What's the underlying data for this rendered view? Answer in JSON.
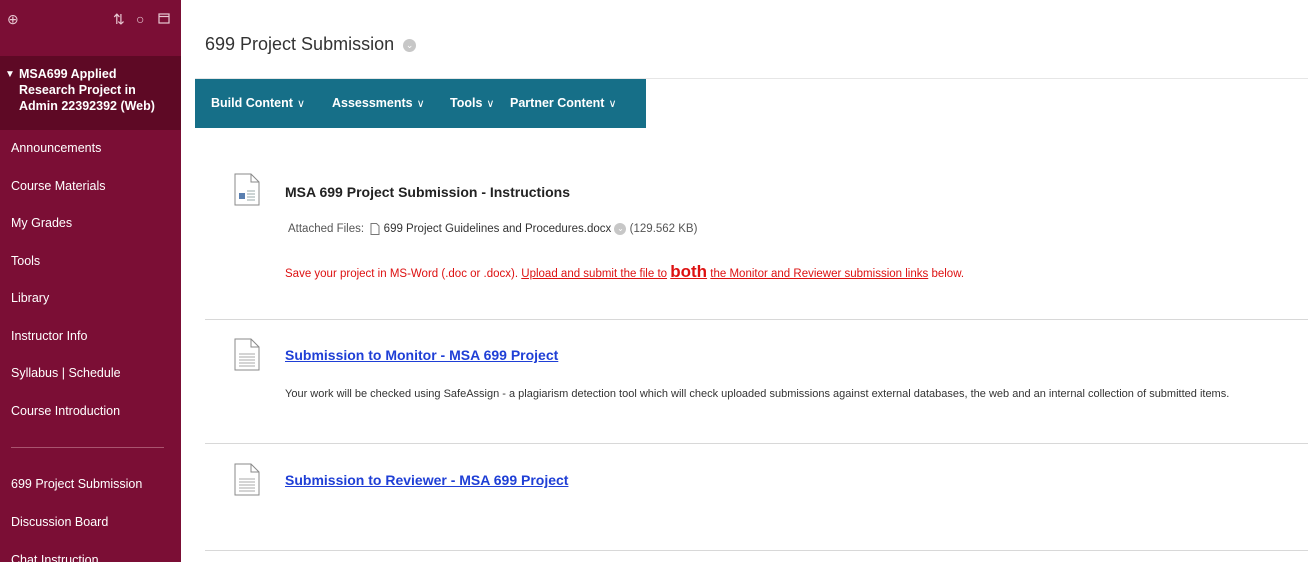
{
  "sidebar": {
    "toolbar_icons": [
      "add-icon",
      "sort-icon",
      "refresh-icon",
      "folder-icon"
    ],
    "course_title": "MSA699 Applied Research Project in Admin 22392392 (Web)",
    "items": [
      {
        "label": "Announcements"
      },
      {
        "label": "Course Materials"
      },
      {
        "label": "My Grades"
      },
      {
        "label": "Tools"
      },
      {
        "label": "Library"
      },
      {
        "label": "Instructor Info"
      },
      {
        "label": "Syllabus | Schedule"
      },
      {
        "label": "Course Introduction"
      }
    ],
    "items2": [
      {
        "label": "699 Project Submission"
      },
      {
        "label": "Discussion Board"
      },
      {
        "label": "Chat Instruction"
      }
    ]
  },
  "header": {
    "title": "699 Project Submission"
  },
  "actionbar": {
    "build_content": "Build Content",
    "assessments": "Assessments",
    "tools": "Tools",
    "partner_content": "Partner Content",
    "caret": "∨"
  },
  "content": {
    "item1": {
      "title": "MSA 699 Project Submission - Instructions",
      "attached_label": "Attached Files:",
      "file_name": "699 Project Guidelines and Procedures.docx",
      "file_size": "(129.562 KB)",
      "note_prefix": "Save your project in MS-Word (.doc or .docx).",
      "note_link_a": "Upload and submit the file to",
      "note_bold": "both",
      "note_link_b": "the Monitor and Reviewer submission links",
      "note_suffix": "below."
    },
    "item2": {
      "title": "Submission to Monitor - MSA 699 Project",
      "description": "Your work will be checked using SafeAssign - a plagiarism detection tool which will check uploaded submissions against external databases, the web and an internal collection of submitted items."
    },
    "item3": {
      "title": "Submission to Reviewer - MSA 699 Project"
    }
  },
  "colors": {
    "sidebar_bg": "#7b0e35",
    "sidebar_course_bg": "#5e0925",
    "actionbar_bg": "#166f88",
    "link": "#1f3fd6",
    "note_red": "#dd1111"
  }
}
